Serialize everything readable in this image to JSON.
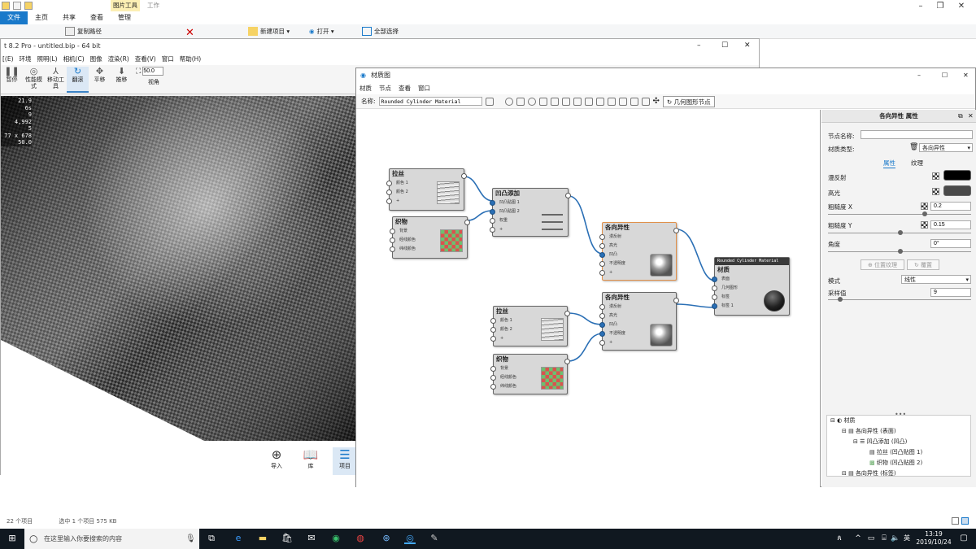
{
  "explorer": {
    "ribbon_tabs": [
      "文件",
      "主页",
      "共享",
      "查看",
      "管理"
    ],
    "context_tab_header": "图片工具",
    "context_tab_work": "工作",
    "ribbon_items": {
      "copy_path": "复制路径",
      "new_item": "新建项目 ▾",
      "open": "打开 ▾",
      "select_all": "全部选择"
    },
    "status_count": "22 个项目",
    "status_selected": "选中 1 个项目  575 KB"
  },
  "keyshot": {
    "title": "t 8.2 Pro - untitled.bip - 64 bit",
    "menu": [
      "[(E)",
      "环境",
      "照明(L)",
      "相机(C)",
      "图像",
      "渲染(R)",
      "查看(V)",
      "窗口",
      "帮助(H)"
    ],
    "toolbar": {
      "pause": "暂停",
      "perf_mode": "性能模式",
      "move_tool": "移动工具",
      "rotate": "翻滚",
      "pan": "平移",
      "push": "推移",
      "view_angle": "视角",
      "zoom_value": "50.0"
    },
    "overlay_stats": [
      "21.9",
      "6s",
      "9",
      "4,992",
      "5",
      "77 x 678",
      "50.0"
    ],
    "bottom_buttons": {
      "import": "导入",
      "library": "库",
      "project": "项目"
    }
  },
  "material_graph": {
    "title": "材质图",
    "menu": [
      "材质",
      "节点",
      "查看",
      "窗口"
    ],
    "name_label": "名称:",
    "name_value": "Rounded Cylinder Material",
    "geo_node_button": "几何图形节点",
    "nodes": {
      "brushed1": {
        "title": "拉丝",
        "rows": [
          "颜色 1",
          "颜色 2",
          "+"
        ]
      },
      "weave1": {
        "title": "织物",
        "rows": [
          "背景",
          "经线颜色",
          "纬线颜色"
        ]
      },
      "bumpadd": {
        "title": "凹凸添加",
        "rows": [
          "凹凸贴图 1",
          "凹凸贴图 2",
          "权重",
          "+"
        ]
      },
      "aniso1": {
        "title": "各向异性",
        "rows": [
          "漫反射",
          "高光",
          "凹凸",
          "不透明度",
          "+"
        ]
      },
      "aniso2": {
        "title": "各向异性",
        "rows": [
          "漫反射",
          "高光",
          "凹凸",
          "不透明度",
          "+"
        ]
      },
      "brushed2": {
        "title": "拉丝",
        "rows": [
          "颜色 1",
          "颜色 2",
          "+"
        ]
      },
      "weave2": {
        "title": "织物",
        "rows": [
          "背景",
          "经线颜色",
          "纬线颜色"
        ]
      },
      "material": {
        "header": "Rounded Cylinder Material",
        "title": "材质",
        "rows": [
          "表面",
          "几何图形",
          "标签",
          "标签 1"
        ]
      }
    },
    "props": {
      "header": "各向异性 属性",
      "node_name_label": "节点名称:",
      "node_name_value": "",
      "material_type_label": "材质类型:",
      "material_type_value": "各向异性",
      "tab_props": "属性",
      "tab_texture": "纹理",
      "diffuse_label": "漫反射",
      "specular_label": "高光",
      "rough_x_label": "粗糙度 X",
      "rough_x_value": "0.2",
      "rough_y_label": "粗糙度 Y",
      "rough_y_value": "0.15",
      "angle_label": "角度",
      "angle_value": "0°",
      "btn_position_texture": "位置纹理",
      "btn_overlay": "覆置",
      "mode_label": "模式",
      "mode_value": "线性",
      "samples_label": "采样值",
      "samples_value": "9",
      "diffuse_color": "#000000",
      "specular_color": "#4a4a4a"
    },
    "tree": [
      "材质",
      "各向异性 (表面)",
      "凹凸添加 (凹凸)",
      "拉丝 (凹凸贴图 1)",
      "织物 (凹凸贴图 2)",
      "各向异性 (标签)"
    ]
  },
  "taskbar": {
    "search_placeholder": "在这里输入你要搜索的内容",
    "ime": "英",
    "time": "13:19",
    "date": "2019/10/24"
  },
  "colors": {
    "accent": "#1979ca",
    "wire": "#2a6fb5",
    "taskbar": "#101820"
  }
}
